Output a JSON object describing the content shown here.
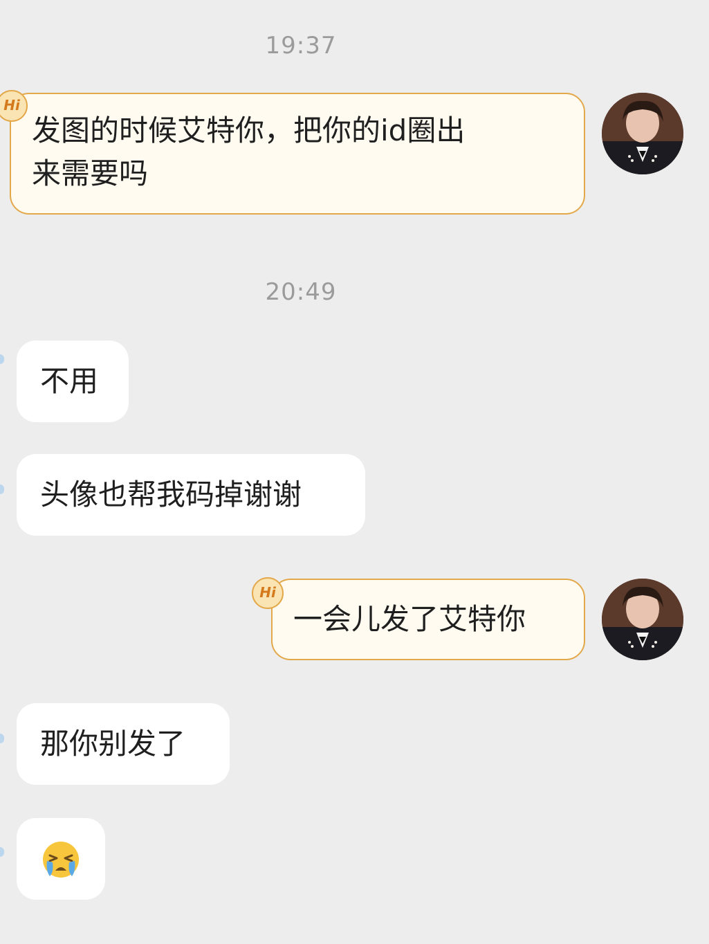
{
  "timestamps": [
    "19:37",
    "20:49"
  ],
  "messages": [
    {
      "sender": "self",
      "text": "发图的时候艾特你，把你的id圈出\n来需要吗"
    },
    {
      "sender": "other",
      "text": "不用"
    },
    {
      "sender": "other",
      "text": "头像也帮我码掉谢谢"
    },
    {
      "sender": "self",
      "text": "一会儿发了艾特你"
    },
    {
      "sender": "other",
      "text": "那你别发了"
    },
    {
      "sender": "other",
      "emoji": "crying-face-icon"
    }
  ],
  "badge_label": "Hi",
  "colors": {
    "background": "#ededed",
    "self_bubble": "#fffbf0",
    "self_border": "#e3a84a",
    "other_bubble": "#ffffff",
    "timestamp": "#9b9b9b"
  }
}
